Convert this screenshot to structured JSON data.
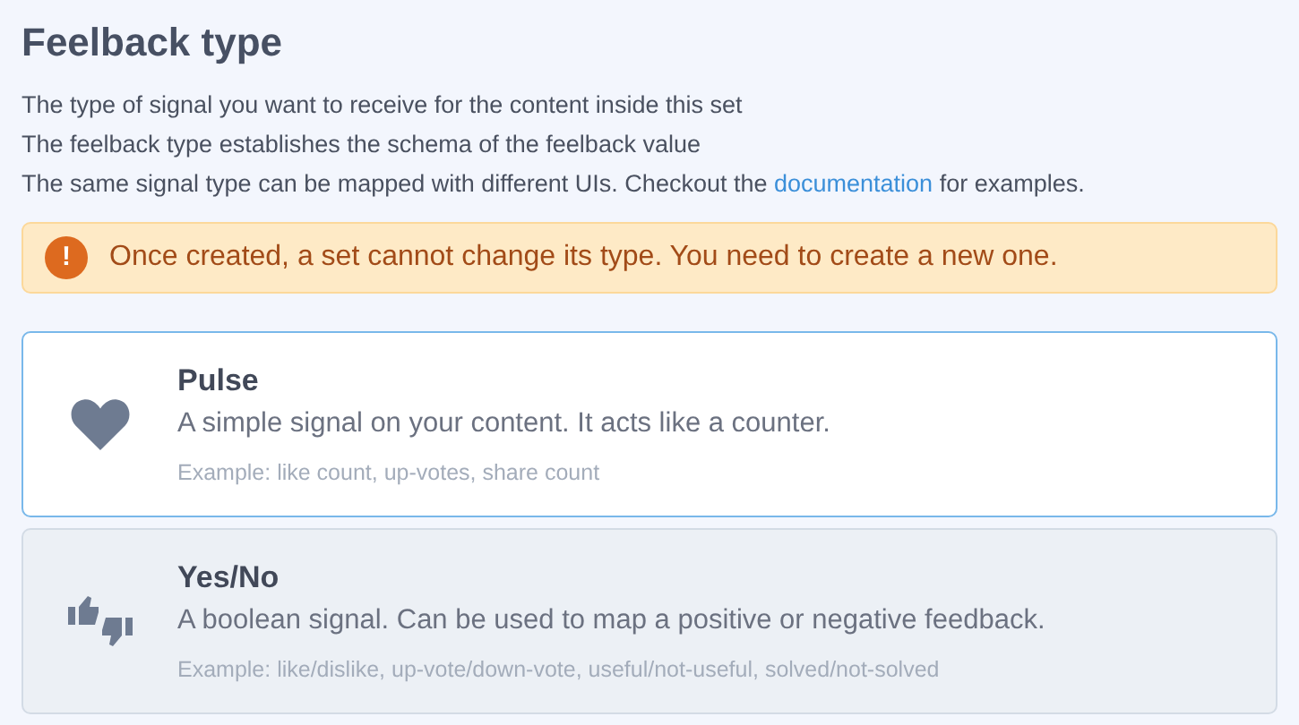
{
  "heading": "Feelback type",
  "description": [
    "The type of signal you want to receive for the content inside this set",
    "The feelback type establishes the schema of the feelback value",
    {
      "before": "The same signal type can be mapped with different UIs. Checkout the",
      "link": "documentation",
      "after": "for examples."
    }
  ],
  "alert": {
    "text": "Once created, a set cannot change its type. You need to create a new one.",
    "icon": "!"
  },
  "options": [
    {
      "kind": "heart",
      "title": "Pulse",
      "description": "A simple signal on your content. It acts like a counter.",
      "example": "Example: like count, up-votes, share count",
      "selected": true
    },
    {
      "kind": "thumbs",
      "title": "Yes/No",
      "description": "A boolean signal. Can be used to map a positive or negative feedback.",
      "example": "Example: like/dislike, up-vote/down-vote, useful/not-useful, solved/not-solved",
      "selected": false
    }
  ]
}
